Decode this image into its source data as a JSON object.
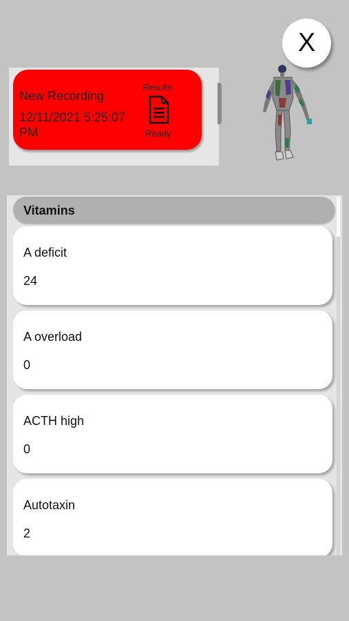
{
  "close_button": {
    "label": "X"
  },
  "recording": {
    "title": "New Recording",
    "datetime": "12/11/2021 5:25:07 PM",
    "results_label": "Results",
    "status": "Ready",
    "card_color": "#ff0000",
    "icon": "document-icon"
  },
  "figure": {
    "icon": "human-body-model"
  },
  "section": {
    "title": "Vitamins"
  },
  "items": [
    {
      "name": "A deficit",
      "value": "24"
    },
    {
      "name": "A overload",
      "value": "0"
    },
    {
      "name": "ACTH high",
      "value": "0"
    },
    {
      "name": "Autotaxin",
      "value": "2"
    }
  ]
}
